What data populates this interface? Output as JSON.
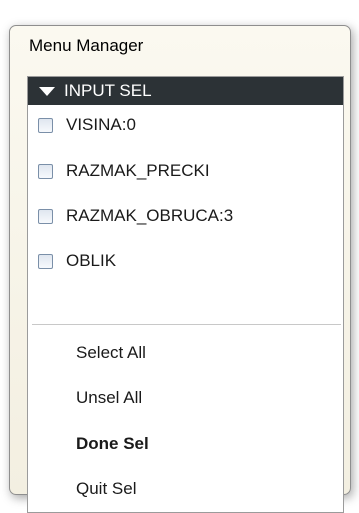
{
  "window": {
    "title": "Menu Manager"
  },
  "menu": {
    "header": "INPUT SEL",
    "items": [
      {
        "label": "VISINA:0"
      },
      {
        "label": "RAZMAK_PRECKI"
      },
      {
        "label": "RAZMAK_OBRUCA:3"
      },
      {
        "label": "OBLIK"
      }
    ],
    "actions": {
      "select_all": "Select All",
      "unsel_all": "Unsel All",
      "done_sel": "Done Sel",
      "quit_sel": "Quit Sel"
    }
  }
}
